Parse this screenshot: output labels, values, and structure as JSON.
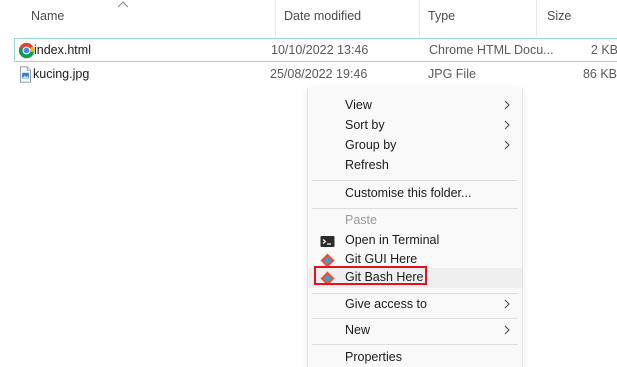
{
  "columns": {
    "name": "Name",
    "date_modified": "Date modified",
    "type": "Type",
    "size": "Size"
  },
  "files": [
    {
      "name": "index.html",
      "date": "10/10/2022 13:46",
      "type": "Chrome HTML Docu...",
      "size": "2 KB",
      "icon": "chrome-icon",
      "selected": true
    },
    {
      "name": "kucing.jpg",
      "date": "25/08/2022 19:46",
      "type": "JPG File",
      "size": "86 KB",
      "icon": "image-file-icon",
      "selected": false
    }
  ],
  "context_menu": {
    "view": "View",
    "sort_by": "Sort by",
    "group_by": "Group by",
    "refresh": "Refresh",
    "customise": "Customise this folder...",
    "paste": "Paste",
    "open_terminal": "Open in Terminal",
    "git_gui": "Git GUI Here",
    "git_bash": "Git Bash Here",
    "give_access": "Give access to",
    "new": "New",
    "properties": "Properties"
  },
  "colors": {
    "selection_border": "#99d9d1",
    "highlight_box": "#e0141e",
    "git_orange": "#f05133",
    "git_blue": "#3a9fd8"
  }
}
